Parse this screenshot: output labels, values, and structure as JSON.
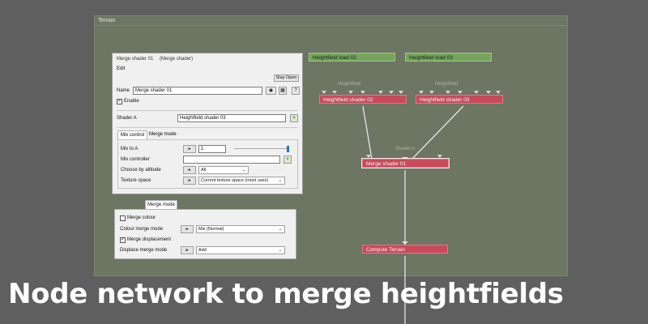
{
  "terrain_window": {
    "title": "Terrain"
  },
  "nodes": {
    "hf_load_02": "Heightfield load 02",
    "hf_load_03": "Heightfield load 03",
    "hf_shader_02": "Heightfield shader 02",
    "hf_shader_03": "Heightfield shader 03",
    "merge_shader_01": "Merge shader 01",
    "compute_terrain": "Compute Terrain",
    "port_label_heightfield": "Heightfield",
    "port_label_shader_a": "Shader A"
  },
  "dialog": {
    "title": "Merge shader 01",
    "subtitle": "(Merge shader)",
    "menu_edit": "Edit",
    "stay_open": "Stay Open",
    "name_label": "Name",
    "name_value": "Merge shader 01",
    "enable_label": "Enable",
    "enable_checked": true,
    "shader_a_label": "Shader A",
    "shader_a_value": "Heightfield shader 03",
    "tabs": [
      "Mix control",
      "Merge mode"
    ],
    "mix_to_a_label": "Mix to A",
    "mix_to_a_value": "1",
    "mix_to_a_slider": 1.0,
    "mix_controller_label": "Mix controller",
    "mix_controller_value": "",
    "choose_by_altitude_label": "Choose by altitude",
    "choose_by_altitude_value": "All",
    "texture_space_label": "Texture space",
    "texture_space_value": "Current texture space (most uses)",
    "anim_icon": "∕▸",
    "plus_icon": "+",
    "help_icon": "?"
  },
  "merge_mode_panel": {
    "tab_label": "Merge mode",
    "merge_colour_label": "Merge colour",
    "merge_colour_checked": false,
    "colour_merge_mode_label": "Colour merge mode",
    "colour_merge_mode_value": "Mix (Normal)",
    "merge_displacement_label": "Merge displacement",
    "merge_displacement_checked": true,
    "displacement_merge_mode_label": "Displace merge mode",
    "displacement_merge_mode_value": "Add"
  },
  "caption": "Node network to merge heightfields",
  "colors": {
    "node_green": "#76a35d",
    "node_red": "#c94a5b",
    "panel_bg": "#6d7563"
  }
}
